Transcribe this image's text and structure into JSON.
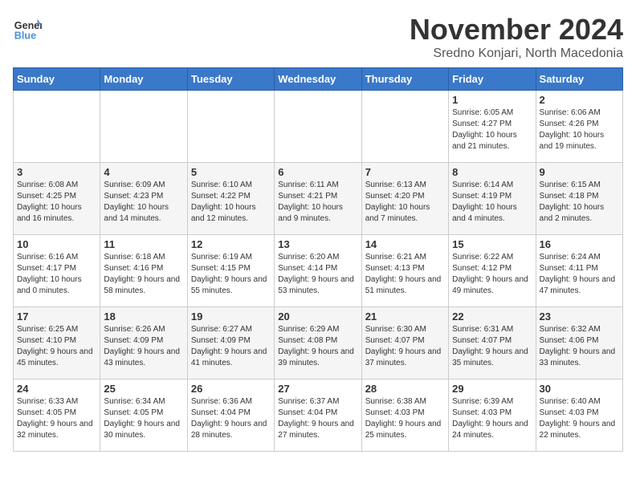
{
  "logo": {
    "general": "General",
    "blue": "Blue"
  },
  "title": "November 2024",
  "subtitle": "Sredno Konjari, North Macedonia",
  "days_of_week": [
    "Sunday",
    "Monday",
    "Tuesday",
    "Wednesday",
    "Thursday",
    "Friday",
    "Saturday"
  ],
  "weeks": [
    [
      {
        "day": "",
        "info": ""
      },
      {
        "day": "",
        "info": ""
      },
      {
        "day": "",
        "info": ""
      },
      {
        "day": "",
        "info": ""
      },
      {
        "day": "",
        "info": ""
      },
      {
        "day": "1",
        "info": "Sunrise: 6:05 AM\nSunset: 4:27 PM\nDaylight: 10 hours and 21 minutes."
      },
      {
        "day": "2",
        "info": "Sunrise: 6:06 AM\nSunset: 4:26 PM\nDaylight: 10 hours and 19 minutes."
      }
    ],
    [
      {
        "day": "3",
        "info": "Sunrise: 6:08 AM\nSunset: 4:25 PM\nDaylight: 10 hours and 16 minutes."
      },
      {
        "day": "4",
        "info": "Sunrise: 6:09 AM\nSunset: 4:23 PM\nDaylight: 10 hours and 14 minutes."
      },
      {
        "day": "5",
        "info": "Sunrise: 6:10 AM\nSunset: 4:22 PM\nDaylight: 10 hours and 12 minutes."
      },
      {
        "day": "6",
        "info": "Sunrise: 6:11 AM\nSunset: 4:21 PM\nDaylight: 10 hours and 9 minutes."
      },
      {
        "day": "7",
        "info": "Sunrise: 6:13 AM\nSunset: 4:20 PM\nDaylight: 10 hours and 7 minutes."
      },
      {
        "day": "8",
        "info": "Sunrise: 6:14 AM\nSunset: 4:19 PM\nDaylight: 10 hours and 4 minutes."
      },
      {
        "day": "9",
        "info": "Sunrise: 6:15 AM\nSunset: 4:18 PM\nDaylight: 10 hours and 2 minutes."
      }
    ],
    [
      {
        "day": "10",
        "info": "Sunrise: 6:16 AM\nSunset: 4:17 PM\nDaylight: 10 hours and 0 minutes."
      },
      {
        "day": "11",
        "info": "Sunrise: 6:18 AM\nSunset: 4:16 PM\nDaylight: 9 hours and 58 minutes."
      },
      {
        "day": "12",
        "info": "Sunrise: 6:19 AM\nSunset: 4:15 PM\nDaylight: 9 hours and 55 minutes."
      },
      {
        "day": "13",
        "info": "Sunrise: 6:20 AM\nSunset: 4:14 PM\nDaylight: 9 hours and 53 minutes."
      },
      {
        "day": "14",
        "info": "Sunrise: 6:21 AM\nSunset: 4:13 PM\nDaylight: 9 hours and 51 minutes."
      },
      {
        "day": "15",
        "info": "Sunrise: 6:22 AM\nSunset: 4:12 PM\nDaylight: 9 hours and 49 minutes."
      },
      {
        "day": "16",
        "info": "Sunrise: 6:24 AM\nSunset: 4:11 PM\nDaylight: 9 hours and 47 minutes."
      }
    ],
    [
      {
        "day": "17",
        "info": "Sunrise: 6:25 AM\nSunset: 4:10 PM\nDaylight: 9 hours and 45 minutes."
      },
      {
        "day": "18",
        "info": "Sunrise: 6:26 AM\nSunset: 4:09 PM\nDaylight: 9 hours and 43 minutes."
      },
      {
        "day": "19",
        "info": "Sunrise: 6:27 AM\nSunset: 4:09 PM\nDaylight: 9 hours and 41 minutes."
      },
      {
        "day": "20",
        "info": "Sunrise: 6:29 AM\nSunset: 4:08 PM\nDaylight: 9 hours and 39 minutes."
      },
      {
        "day": "21",
        "info": "Sunrise: 6:30 AM\nSunset: 4:07 PM\nDaylight: 9 hours and 37 minutes."
      },
      {
        "day": "22",
        "info": "Sunrise: 6:31 AM\nSunset: 4:07 PM\nDaylight: 9 hours and 35 minutes."
      },
      {
        "day": "23",
        "info": "Sunrise: 6:32 AM\nSunset: 4:06 PM\nDaylight: 9 hours and 33 minutes."
      }
    ],
    [
      {
        "day": "24",
        "info": "Sunrise: 6:33 AM\nSunset: 4:05 PM\nDaylight: 9 hours and 32 minutes."
      },
      {
        "day": "25",
        "info": "Sunrise: 6:34 AM\nSunset: 4:05 PM\nDaylight: 9 hours and 30 minutes."
      },
      {
        "day": "26",
        "info": "Sunrise: 6:36 AM\nSunset: 4:04 PM\nDaylight: 9 hours and 28 minutes."
      },
      {
        "day": "27",
        "info": "Sunrise: 6:37 AM\nSunset: 4:04 PM\nDaylight: 9 hours and 27 minutes."
      },
      {
        "day": "28",
        "info": "Sunrise: 6:38 AM\nSunset: 4:03 PM\nDaylight: 9 hours and 25 minutes."
      },
      {
        "day": "29",
        "info": "Sunrise: 6:39 AM\nSunset: 4:03 PM\nDaylight: 9 hours and 24 minutes."
      },
      {
        "day": "30",
        "info": "Sunrise: 6:40 AM\nSunset: 4:03 PM\nDaylight: 9 hours and 22 minutes."
      }
    ]
  ]
}
